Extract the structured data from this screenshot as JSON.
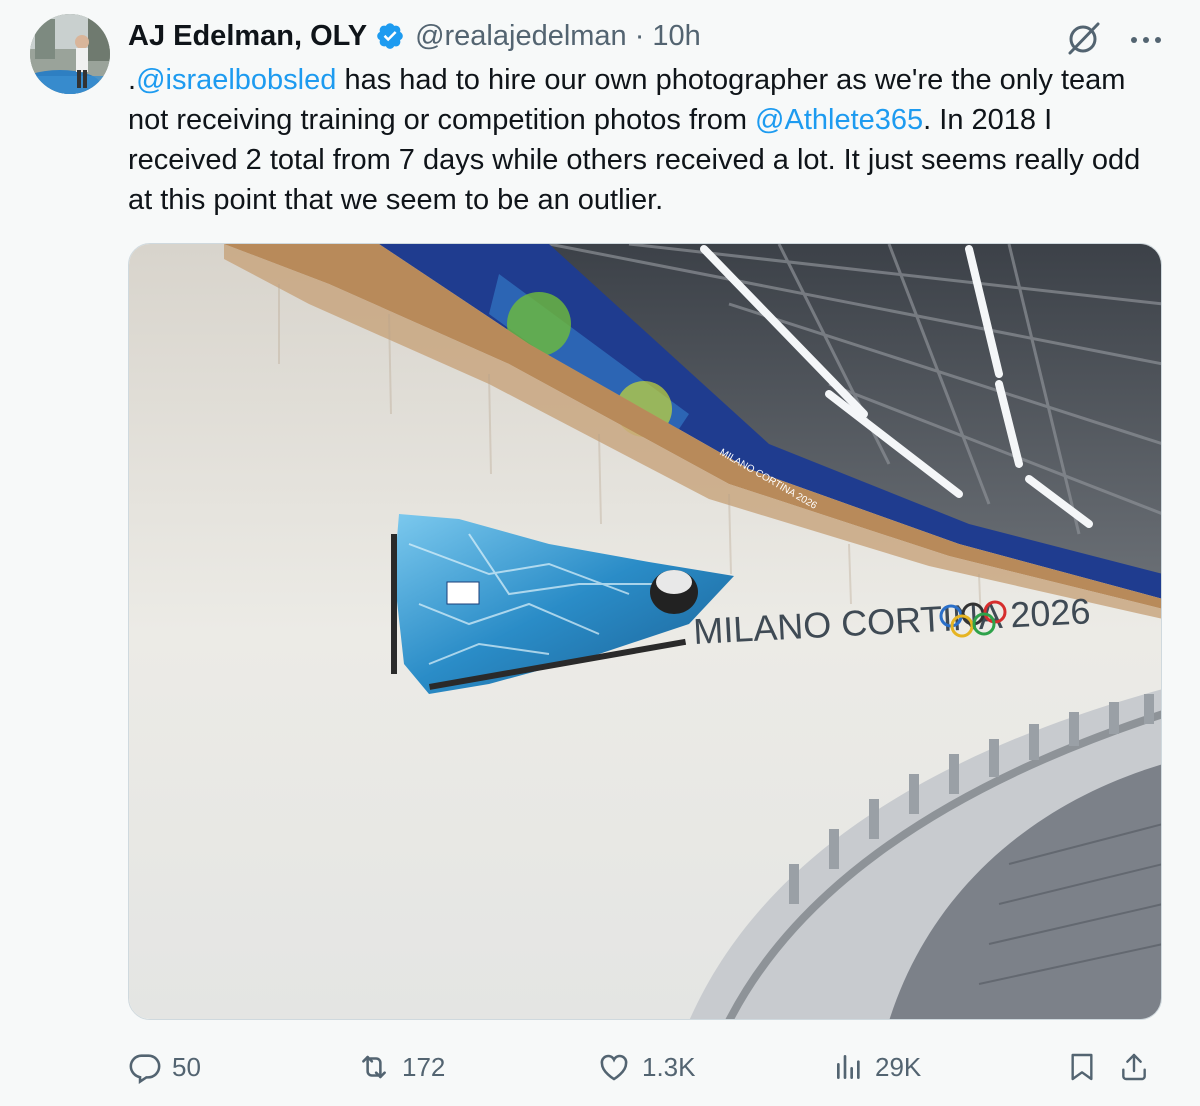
{
  "tweet": {
    "display_name": "AJ Edelman, OLY",
    "handle": "@realajedelman",
    "separator": "·",
    "time": "10h",
    "text_parts": [
      ".",
      "@israelbobsled",
      " has had to hire our own photographer as we're the only team not receiving training or competition photos from ",
      "@Athlete365",
      ". In 2018 I received 2 total from 7 days while others received a lot. It just seems really odd at this point that we seem to be an outlier."
    ],
    "photo": {
      "track_banner_text": "MILANO CORTINA 2026",
      "sponsor_band_text": "MILANO CORTINA 2026"
    }
  },
  "actions": {
    "replies": "50",
    "reposts": "172",
    "likes": "1.3K",
    "views": "29K"
  },
  "colors": {
    "background": "#f7f9f9",
    "text": "#0f1419",
    "muted": "#536471",
    "link": "#1d9bf0",
    "verified": "#1d9bf0"
  },
  "icons": [
    "verified-badge-icon",
    "grok-icon",
    "more-icon",
    "reply-icon",
    "repost-icon",
    "like-icon",
    "views-icon",
    "bookmark-icon",
    "share-icon"
  ]
}
